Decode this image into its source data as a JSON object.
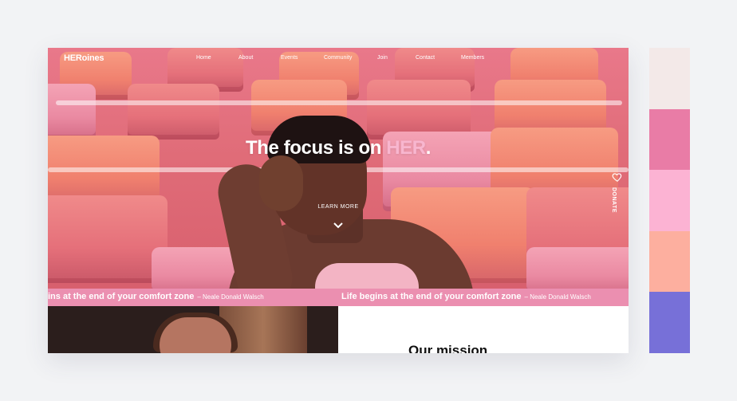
{
  "nav": {
    "logo_prefix": "HER",
    "logo_suffix": "oines",
    "links": [
      "Home",
      "About",
      "Events",
      "Community",
      "Join",
      "Contact",
      "Members"
    ]
  },
  "hero": {
    "headline_prefix": "The focus is on ",
    "headline_highlight": "HER",
    "headline_suffix": ".",
    "learn_more": "LEARN MORE",
    "donate": "DONATE"
  },
  "ticker": {
    "quote_partial": "ins at the end of your comfort zone",
    "quote_full": "Life begins at the end of your comfort zone",
    "author": "– Neale Donald Walsch"
  },
  "mission": {
    "title": "Our mission"
  },
  "colors": {
    "accent_pink": "#f8b6cf",
    "ticker_bg": "#eb8fb0",
    "palette": [
      "#f3e9e8",
      "#e97ca6",
      "#fcb3d3",
      "#fdaf9f",
      "#7770d8"
    ]
  }
}
